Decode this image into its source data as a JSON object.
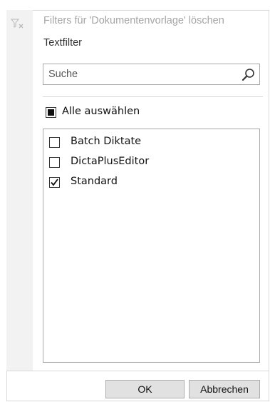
{
  "header": {
    "clear_filter_label": "Filters für 'Dokumentenvorlage' löschen",
    "clear_filter_icon": "funnel-x-icon"
  },
  "text_filter": {
    "label": "Textfilter",
    "search_placeholder": "Suche",
    "search_icon": "search-icon"
  },
  "select_all": {
    "label": "Alle auswählen",
    "state": "indeterminate"
  },
  "items": [
    {
      "label": "Batch Diktate",
      "checked": false
    },
    {
      "label": "DictaPlusEditor",
      "checked": false
    },
    {
      "label": "Standard",
      "checked": true
    }
  ],
  "buttons": {
    "ok": "OK",
    "cancel": "Abbrechen"
  },
  "colors": {
    "disabled_text": "#a5a5a5",
    "button_bg": "#e1e1e1",
    "gutter_bg": "#f2f2f2"
  }
}
